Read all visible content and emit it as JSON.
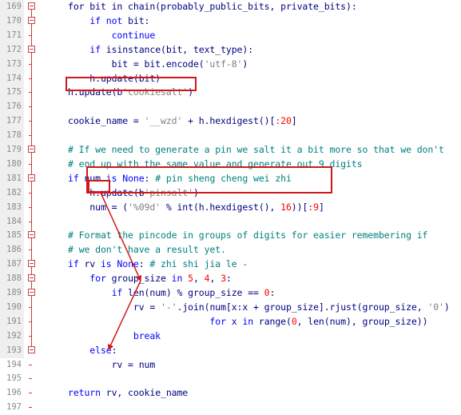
{
  "editor": {
    "lines": [
      {
        "n": "169",
        "fold": true,
        "segs": [
          [
            "txt",
            "for bit in chain(probably_public_bits, private_bits):"
          ]
        ]
      },
      {
        "n": "170",
        "fold": true,
        "segs": [
          [
            "txt",
            "    "
          ],
          [
            "kw",
            "if not"
          ],
          [
            "txt",
            " bit:"
          ]
        ]
      },
      {
        "n": "171",
        "fold": false,
        "segs": [
          [
            "kw",
            "        continue"
          ]
        ]
      },
      {
        "n": "172",
        "fold": true,
        "segs": [
          [
            "txt",
            "    "
          ],
          [
            "kw",
            "if"
          ],
          [
            "txt",
            " isinstance(bit, text_type):"
          ]
        ]
      },
      {
        "n": "173",
        "fold": false,
        "segs": [
          [
            "txt",
            "        bit = bit.encode("
          ],
          [
            "str",
            "'utf-8'"
          ],
          [
            "txt",
            ")"
          ]
        ]
      },
      {
        "n": "174",
        "fold": false,
        "segs": [
          [
            "txt",
            "    h.update(bit)"
          ]
        ]
      },
      {
        "n": "175",
        "fold": false,
        "segs": [
          [
            "txt",
            "h.update(b"
          ],
          [
            "str",
            "'cookiesalt'"
          ],
          [
            "txt",
            ")"
          ]
        ]
      },
      {
        "n": "176",
        "fold": false,
        "segs": [
          [
            "txt",
            ""
          ]
        ]
      },
      {
        "n": "177",
        "fold": false,
        "segs": [
          [
            "txt",
            "cookie_name = "
          ],
          [
            "str",
            "'__wzd'"
          ],
          [
            "txt",
            " + h.hexdigest()["
          ],
          [
            "num",
            ":20"
          ],
          [
            "txt",
            "]"
          ]
        ]
      },
      {
        "n": "178",
        "fold": false,
        "segs": [
          [
            "txt",
            ""
          ]
        ]
      },
      {
        "n": "179",
        "fold": true,
        "segs": [
          [
            "cmt",
            "# If we need to generate a pin we salt it a bit more so that we don't"
          ]
        ]
      },
      {
        "n": "180",
        "fold": false,
        "segs": [
          [
            "cmt",
            "# end up with the same value and generate out 9 digits"
          ]
        ]
      },
      {
        "n": "181",
        "fold": true,
        "segs": [
          [
            "kw",
            "if"
          ],
          [
            "txt",
            " num "
          ],
          [
            "kw",
            "is None"
          ],
          [
            "txt",
            ": "
          ],
          [
            "cmt",
            "# pin sheng cheng wei zhi"
          ]
        ]
      },
      {
        "n": "182",
        "fold": false,
        "segs": [
          [
            "txt",
            "    h.update(b"
          ],
          [
            "str",
            "'pinsalt'"
          ],
          [
            "txt",
            ")"
          ]
        ]
      },
      {
        "n": "183",
        "fold": false,
        "segs": [
          [
            "txt",
            "    num = ("
          ],
          [
            "str",
            "'%09d'"
          ],
          [
            "txt",
            " % int(h.hexdigest(), "
          ],
          [
            "num",
            "16"
          ],
          [
            "txt",
            "))["
          ],
          [
            "num",
            ":9"
          ],
          [
            "txt",
            "]"
          ]
        ]
      },
      {
        "n": "184",
        "fold": false,
        "segs": [
          [
            "txt",
            ""
          ]
        ]
      },
      {
        "n": "185",
        "fold": true,
        "segs": [
          [
            "cmt",
            "# Format the pincode in groups of digits for easier remembering if"
          ]
        ]
      },
      {
        "n": "186",
        "fold": false,
        "segs": [
          [
            "cmt",
            "# we don't have a result yet."
          ]
        ]
      },
      {
        "n": "187",
        "fold": true,
        "segs": [
          [
            "kw",
            "if"
          ],
          [
            "txt",
            " rv "
          ],
          [
            "kw",
            "is None"
          ],
          [
            "txt",
            ": "
          ],
          [
            "cmt",
            "# zhi shi jia le -"
          ]
        ]
      },
      {
        "n": "188",
        "fold": true,
        "segs": [
          [
            "txt",
            "    "
          ],
          [
            "kw",
            "for"
          ],
          [
            "txt",
            " group_size "
          ],
          [
            "kw",
            "in"
          ],
          [
            "txt",
            " "
          ],
          [
            "num",
            "5"
          ],
          [
            "txt",
            ", "
          ],
          [
            "num",
            "4"
          ],
          [
            "txt",
            ", "
          ],
          [
            "num",
            "3"
          ],
          [
            "txt",
            ":"
          ]
        ]
      },
      {
        "n": "189",
        "fold": true,
        "segs": [
          [
            "txt",
            "        "
          ],
          [
            "kw",
            "if"
          ],
          [
            "txt",
            " len(num) % group_size == "
          ],
          [
            "num",
            "0"
          ],
          [
            "txt",
            ":"
          ]
        ]
      },
      {
        "n": "190",
        "fold": false,
        "segs": [
          [
            "txt",
            "            rv = "
          ],
          [
            "str",
            "'-'"
          ],
          [
            "txt",
            ".join(num[x:x + group_size].rjust(group_size, "
          ],
          [
            "str",
            "'0'"
          ],
          [
            "txt",
            ")"
          ]
        ]
      },
      {
        "n": "191",
        "fold": false,
        "segs": [
          [
            "txt",
            "                          "
          ],
          [
            "kw",
            "for"
          ],
          [
            "txt",
            " x "
          ],
          [
            "kw",
            "in"
          ],
          [
            "txt",
            " range("
          ],
          [
            "num",
            "0"
          ],
          [
            "txt",
            ", len(num), group_size))"
          ]
        ]
      },
      {
        "n": "192",
        "fold": false,
        "segs": [
          [
            "kw",
            "            break"
          ]
        ]
      },
      {
        "n": "193",
        "fold": true,
        "segs": [
          [
            "txt",
            "    "
          ],
          [
            "kw",
            "else"
          ],
          [
            "txt",
            ":"
          ]
        ]
      },
      {
        "n": "194",
        "fold": false,
        "segs": [
          [
            "txt",
            "        rv = num"
          ]
        ]
      },
      {
        "n": "195",
        "fold": false,
        "segs": [
          [
            "txt",
            ""
          ]
        ]
      },
      {
        "n": "196",
        "fold": false,
        "segs": [
          [
            "kw",
            "return"
          ],
          [
            "txt",
            " rv, cookie_name"
          ]
        ]
      },
      {
        "n": "197",
        "fold": false,
        "segs": [
          [
            "txt",
            ""
          ]
        ]
      }
    ]
  },
  "colors": {
    "keyword": "#0000ff",
    "text": "#000080",
    "string": "#808080",
    "number": "#ff0000",
    "comment": "#008080",
    "highlight": "#d01818"
  }
}
